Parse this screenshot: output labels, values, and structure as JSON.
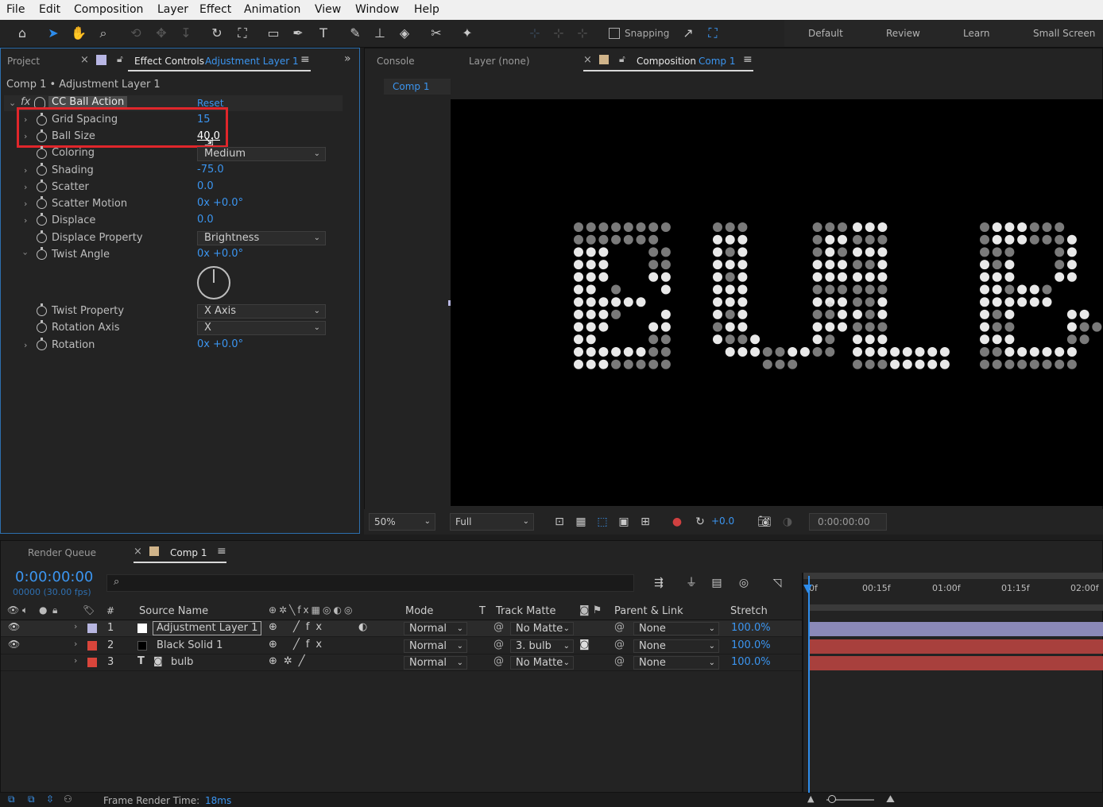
{
  "menu": [
    "File",
    "Edit",
    "Composition",
    "Layer",
    "Effect",
    "Animation",
    "View",
    "Window",
    "Help"
  ],
  "toolbar": {
    "snapping_label": "Snapping",
    "workspaces": [
      "Default",
      "Review",
      "Learn",
      "Small Screen"
    ]
  },
  "effect_panel": {
    "tab_project": "Project",
    "tab_effect_controls": "Effect Controls",
    "tab_effect_layer": "Adjustment Layer 1",
    "breadcrumb": "Comp 1 • Adjustment Layer 1",
    "effect_name": "CC Ball Action",
    "reset_label": "Reset",
    "properties": [
      {
        "name": "Grid Spacing",
        "value": "15"
      },
      {
        "name": "Ball Size",
        "value": "40.0"
      },
      {
        "name": "Coloring",
        "value": "Medium"
      },
      {
        "name": "Shading",
        "value": "-75.0"
      },
      {
        "name": "Scatter",
        "value": "0.0"
      },
      {
        "name": "Scatter Motion",
        "value": "0x",
        "value2": "+0.0°"
      },
      {
        "name": "Displace",
        "value": "0.0"
      },
      {
        "name": "Displace Property",
        "value": "Brightness"
      },
      {
        "name": "Twist Angle",
        "value": "0x",
        "value2": "+0.0°"
      },
      {
        "name": "Twist Property",
        "value": "X Axis"
      },
      {
        "name": "Rotation Axis",
        "value": "X"
      },
      {
        "name": "Rotation",
        "value": "0x",
        "value2": "+0.0°"
      }
    ]
  },
  "viewer": {
    "tab_console": "Console",
    "tab_layer": "Layer (none)",
    "tab_composition": "Composition",
    "tab_comp_name": "Comp 1",
    "subtab": "Comp 1",
    "zoom": "50%",
    "resolution": "Full",
    "exposure": "+0.0",
    "timecode": "0:00:00:00"
  },
  "timeline": {
    "tab_render_queue": "Render Queue",
    "tab_comp": "Comp 1",
    "timecode": "0:00:00:00",
    "frames": "00000 (30.00 fps)",
    "search_placeholder": "",
    "ruler": [
      "0f",
      "00:15f",
      "01:00f",
      "01:15f",
      "02:00f"
    ],
    "headers": {
      "num": "#",
      "source": "Source Name",
      "mode": "Mode",
      "t": "T",
      "matte": "Track Matte",
      "parent": "Parent & Link",
      "stretch": "Stretch"
    },
    "layers": [
      {
        "num": "1",
        "name": "Adjustment Layer 1",
        "mode": "Normal",
        "matte": "No Matte",
        "parent": "None",
        "stretch": "100.0%",
        "label_color": "#b7b6e0"
      },
      {
        "num": "2",
        "name": "Black Solid 1",
        "mode": "Normal",
        "matte": "3. bulb",
        "parent": "None",
        "stretch": "100.0%",
        "label_color": "#d9453b"
      },
      {
        "num": "3",
        "name": "bulb",
        "mode": "Normal",
        "matte": "No Matte",
        "parent": "None",
        "stretch": "100.0%",
        "label_color": "#d9453b"
      }
    ]
  },
  "status": {
    "label": "Frame Render Time:",
    "value": "18ms"
  },
  "colors": {
    "accent": "#3b95f0",
    "highlight_box": "#e0262b",
    "adjustment_bar": "#8b89b8",
    "solid_bar": "#a8403d"
  }
}
